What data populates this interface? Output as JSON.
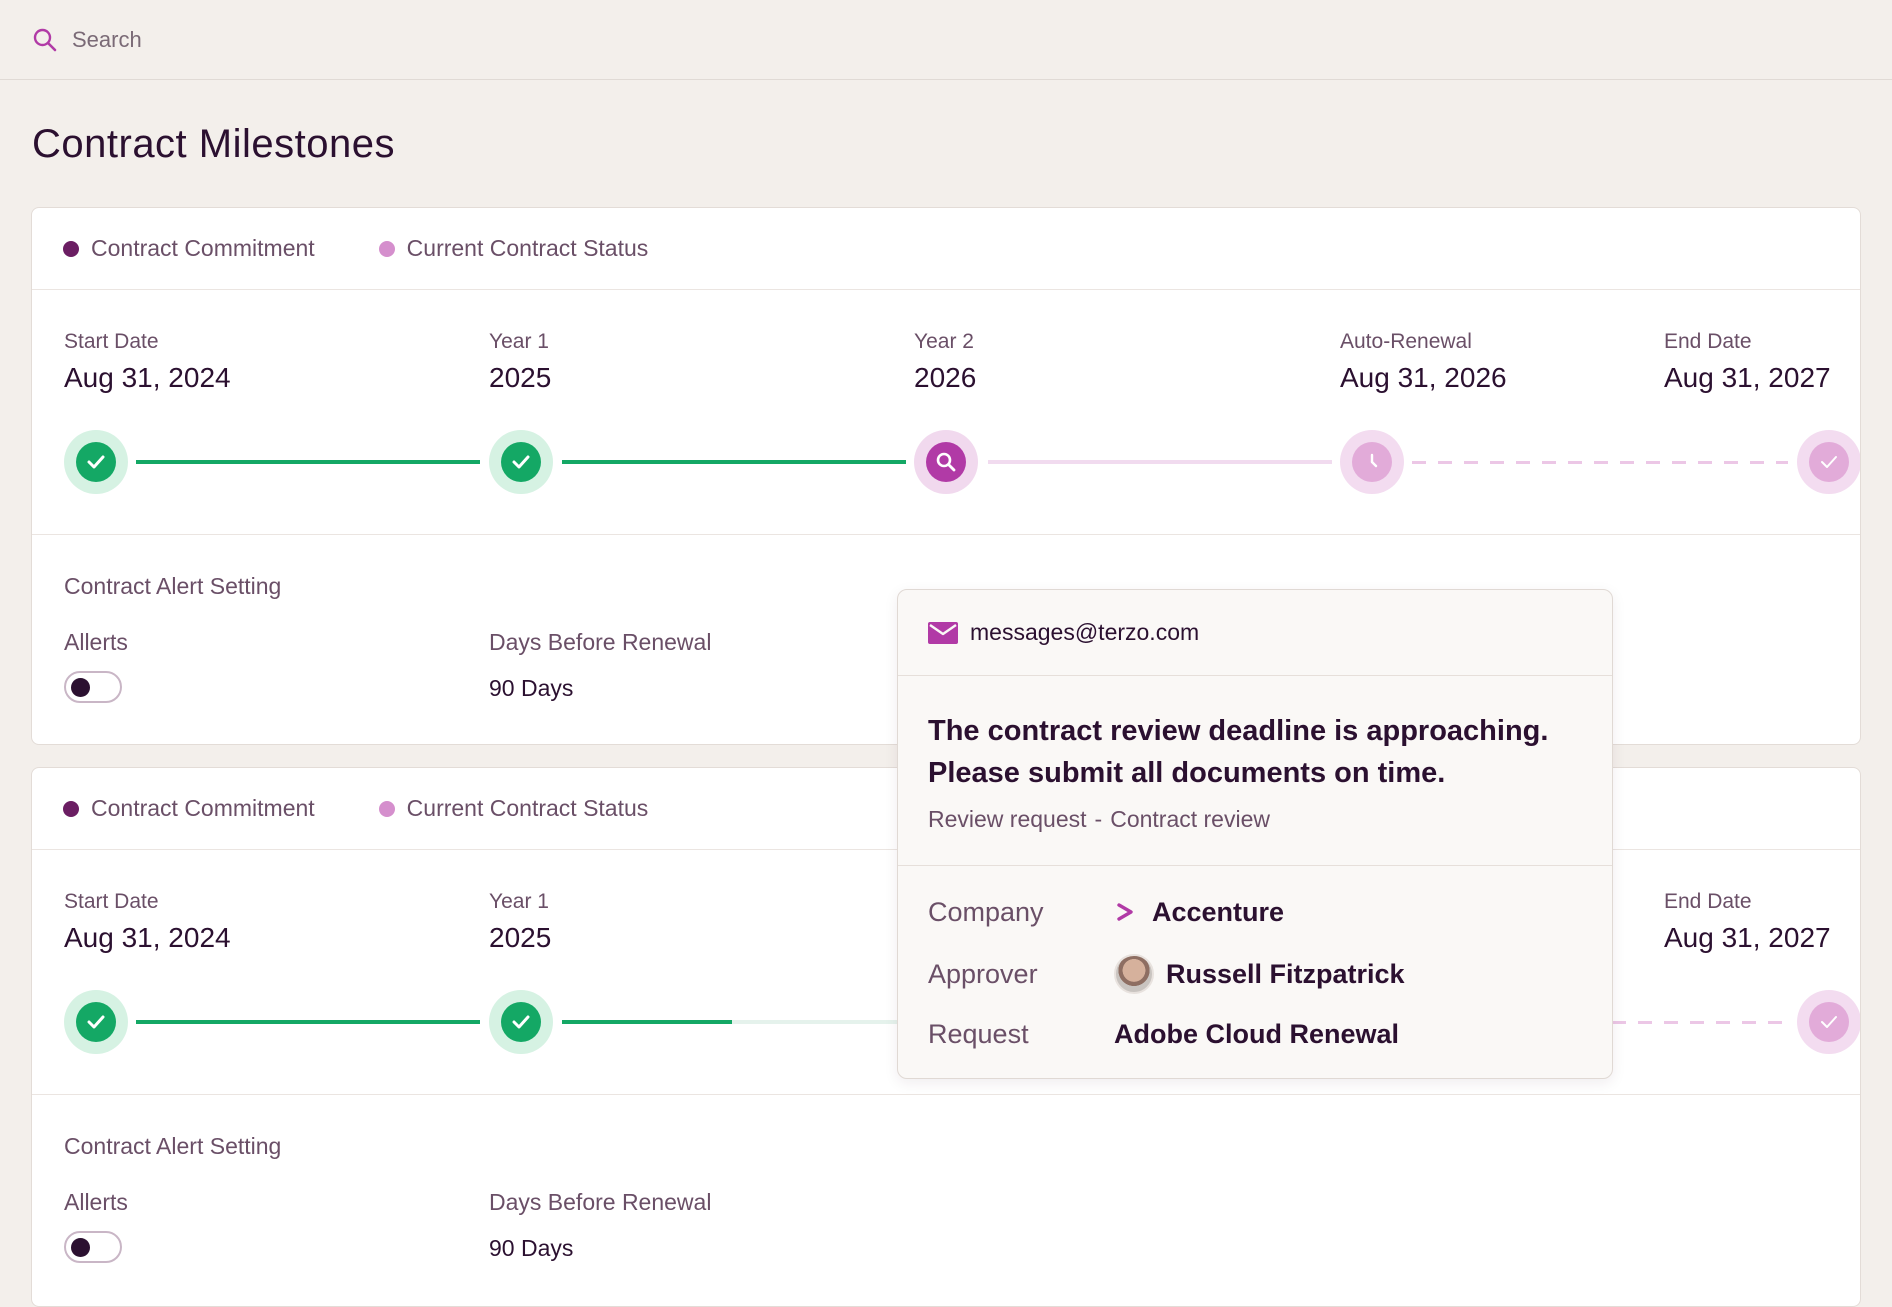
{
  "search": {
    "placeholder": "Search"
  },
  "page": {
    "title": "Contract Milestones"
  },
  "legend": {
    "commitment": "Contract Commitment",
    "status": "Current Contract Status",
    "commitment_color": "#6b1e63",
    "status_color": "#d58fcd"
  },
  "cards": [
    {
      "milestones": [
        {
          "label": "Start Date",
          "value": "Aug 31, 2024",
          "state": "done"
        },
        {
          "label": "Year 1",
          "value": "2025",
          "state": "done"
        },
        {
          "label": "Year 2",
          "value": "2026",
          "state": "current"
        },
        {
          "label": "Auto-Renewal",
          "value": "Aug 31, 2026",
          "state": "upcoming"
        },
        {
          "label": "End Date",
          "value": "Aug 31, 2027",
          "state": "upcoming"
        }
      ],
      "alerts": {
        "title": "Contract Alert Setting",
        "alerts_label": "Allerts",
        "alerts_enabled": false,
        "days_label": "Days Before Renewal",
        "days_value": "90 Days"
      }
    },
    {
      "milestones": [
        {
          "label": "Start Date",
          "value": "Aug 31, 2024",
          "state": "done"
        },
        {
          "label": "Year 1",
          "value": "2025",
          "state": "done"
        },
        {
          "label": "End Date",
          "value": "Aug 31, 2027",
          "state": "upcoming"
        }
      ],
      "alerts": {
        "title": "Contract Alert Setting",
        "alerts_label": "Allerts",
        "alerts_enabled": false,
        "days_label": "Days Before Renewal",
        "days_value": "90 Days"
      }
    }
  ],
  "popover": {
    "email": "messages@terzo.com",
    "message_line1": "The contract review deadline is approaching.",
    "message_line2": "Please submit all documents on time.",
    "meta_type": "Review request",
    "meta_separator": "-",
    "meta_category": "Contract review",
    "company_label": "Company",
    "company_value": "Accenture",
    "approver_label": "Approver",
    "approver_value": "Russell Fitzpatrick",
    "request_label": "Request",
    "request_value": "Adobe Cloud Renewal"
  }
}
